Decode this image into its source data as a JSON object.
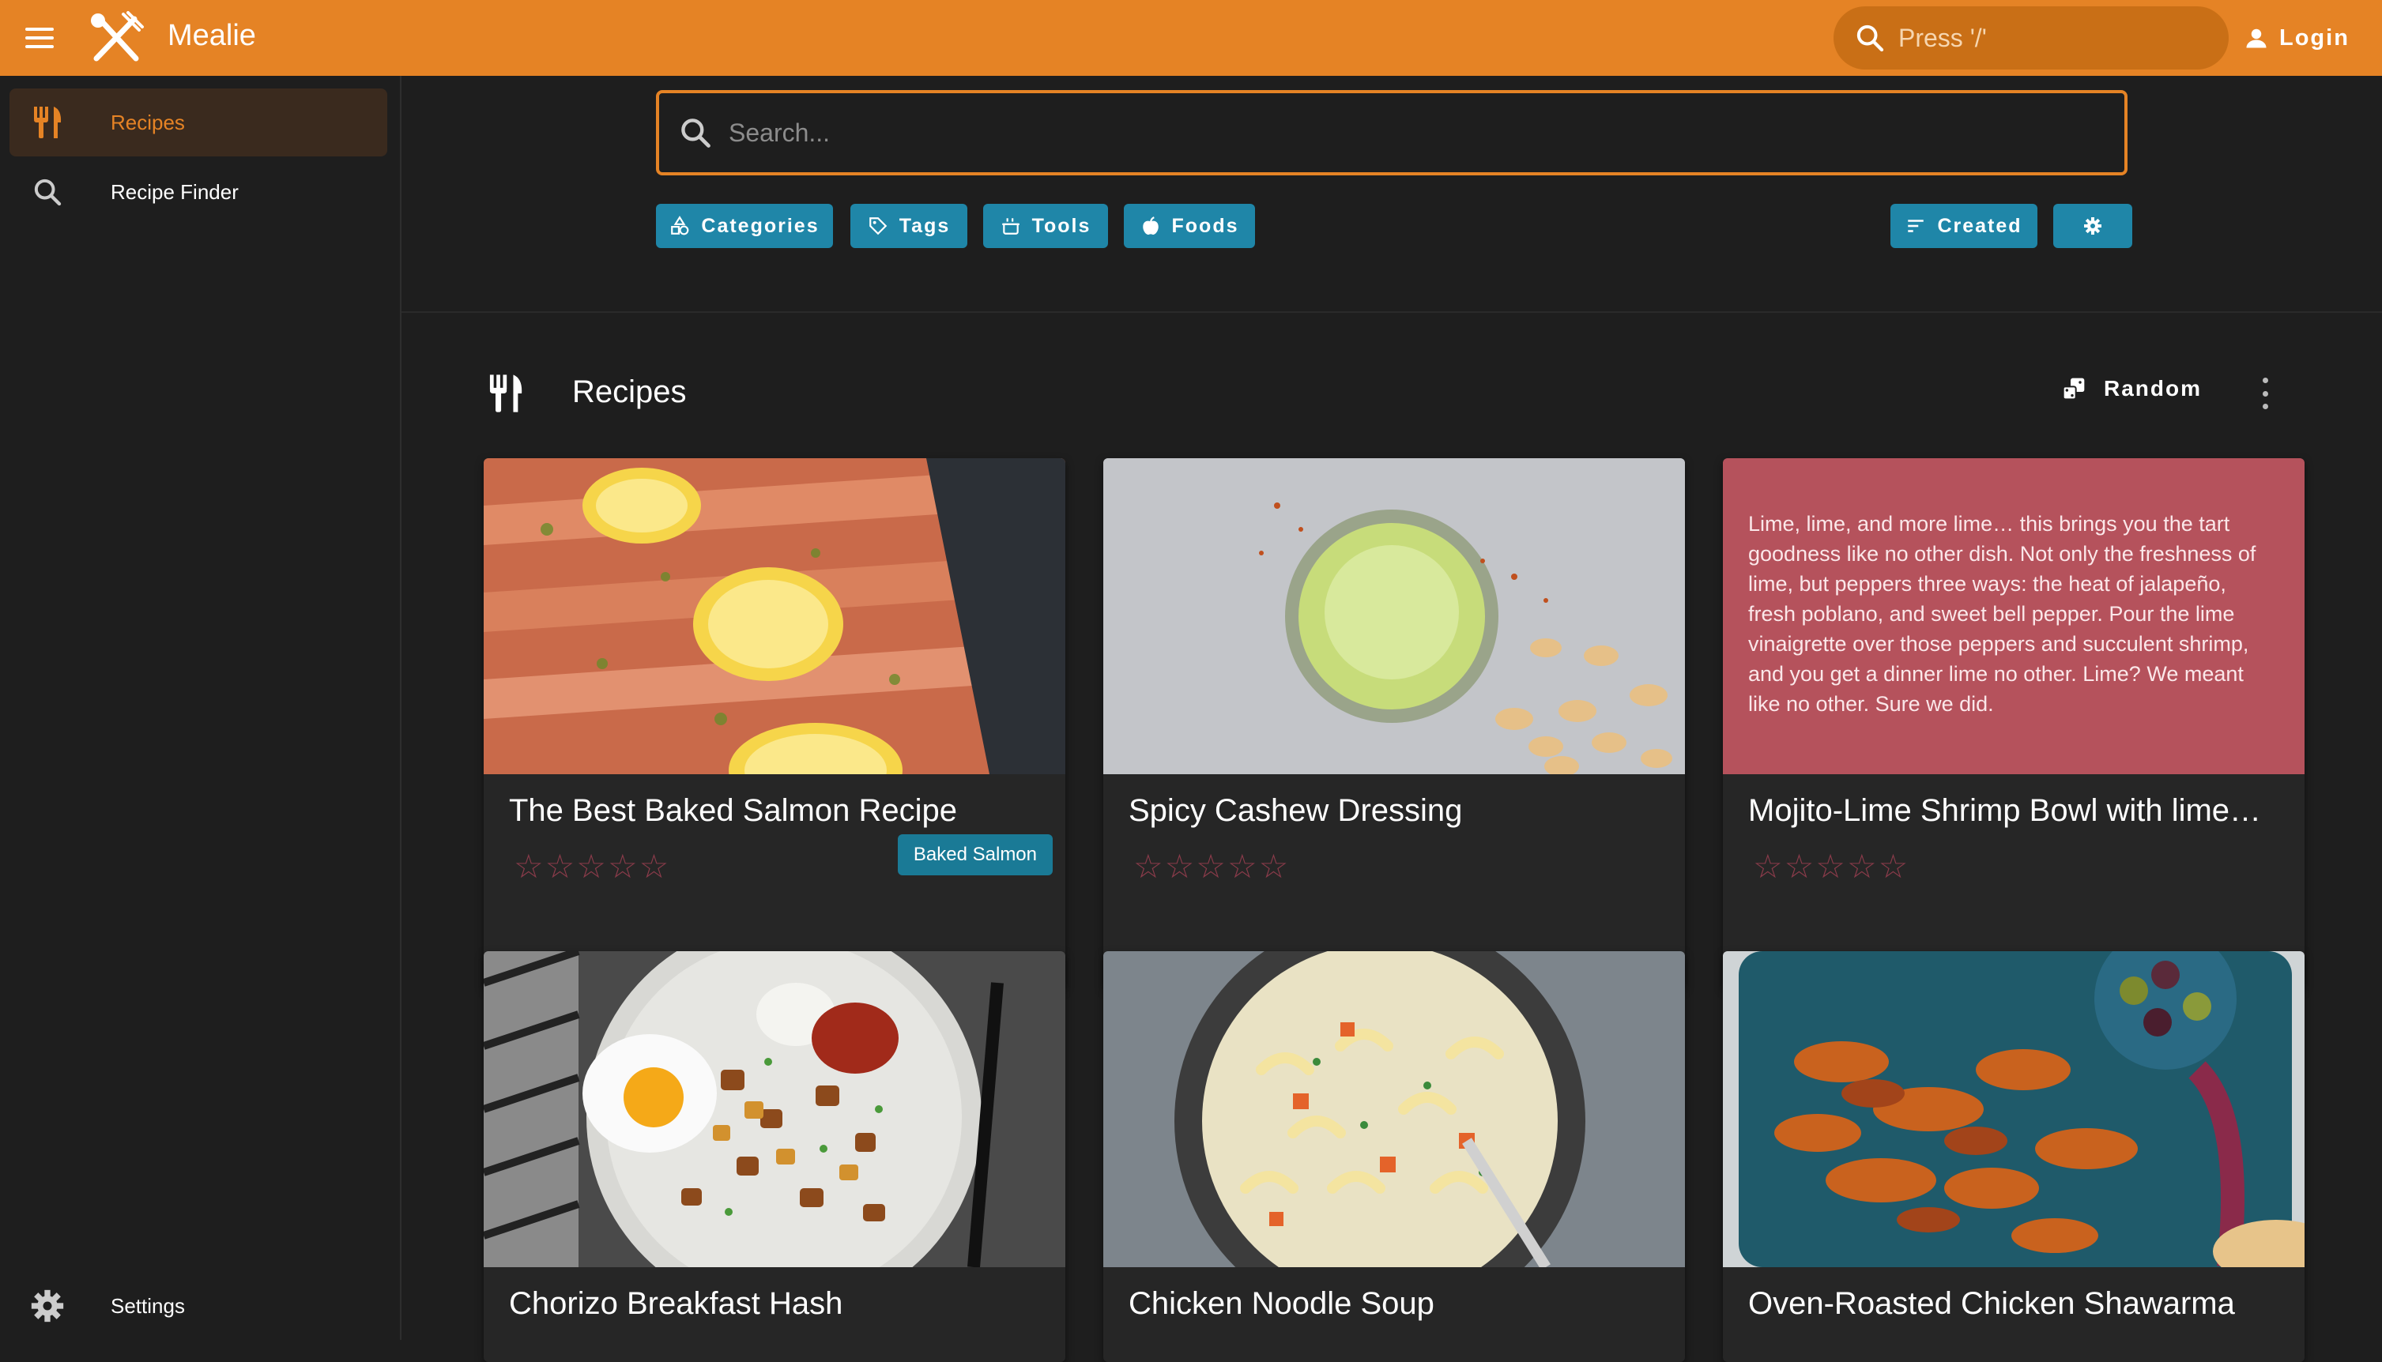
{
  "app": {
    "title": "Mealie"
  },
  "header": {
    "search_placeholder": "Press '/'",
    "login_label": "Login"
  },
  "sidebar": {
    "items": [
      {
        "label": "Recipes",
        "icon": "fork-knife-icon",
        "active": true
      },
      {
        "label": "Recipe Finder",
        "icon": "search-icon",
        "active": false
      }
    ],
    "settings_label": "Settings"
  },
  "search": {
    "placeholder": "Search..."
  },
  "filters": [
    {
      "label": "Categories",
      "icon": "categories-icon"
    },
    {
      "label": "Tags",
      "icon": "tag-icon"
    },
    {
      "label": "Tools",
      "icon": "pot-icon"
    },
    {
      "label": "Foods",
      "icon": "apple-icon"
    }
  ],
  "sort": {
    "label": "Created",
    "icon": "sort-icon"
  },
  "settings_icon": "gear-icon",
  "section": {
    "title": "Recipes",
    "random_label": "Random"
  },
  "colors": {
    "accent": "#e58325",
    "secondary": "#1f86a8",
    "background": "#1e1e1e",
    "card": "#262626"
  },
  "recipes": [
    {
      "name": "The Best Baked Salmon Recipe",
      "rating": 0,
      "tag": "Baked Salmon",
      "image": "salmon"
    },
    {
      "name": "Spicy Cashew Dressing",
      "rating": 0,
      "tag": "",
      "image": "dressing"
    },
    {
      "name": "Mojito-Lime Shrimp Bowl with lime…",
      "rating": 0,
      "tag": "",
      "description": "Lime, lime, and more lime… this brings you the tart goodness like no other dish. Not only the freshness of lime, but peppers three ways: the heat of jalapeño, fresh poblano, and sweet bell pepper. Pour the lime vinaigrette over those peppers and succulent shrimp, and you get a dinner lime no other. Lime? We meant like no other. Sure we did."
    },
    {
      "name": "Chorizo Breakfast Hash",
      "rating": 0,
      "tag": "",
      "image": "hash"
    },
    {
      "name": "Chicken Noodle Soup",
      "rating": 0,
      "tag": "",
      "image": "soup"
    },
    {
      "name": "Oven-Roasted Chicken Shawarma",
      "rating": 0,
      "tag": "",
      "image": "shawarma"
    }
  ],
  "stars_text": "☆☆☆☆☆"
}
